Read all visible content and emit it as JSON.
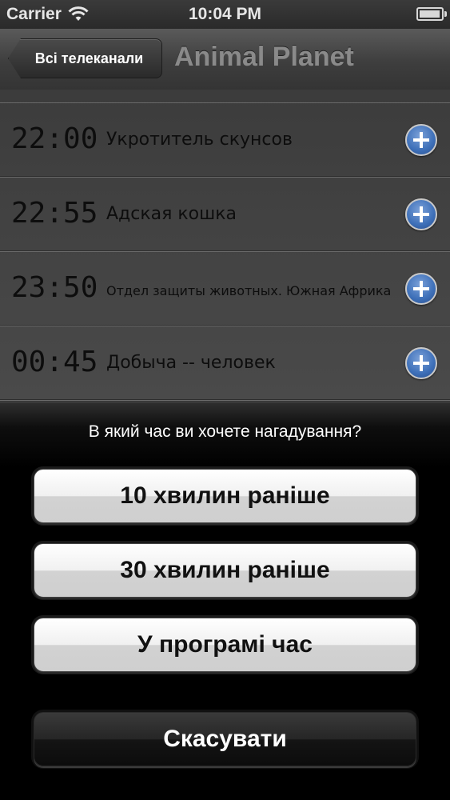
{
  "status_bar": {
    "carrier": "Carrier",
    "time": "10:04 PM",
    "battery_level": 0.95
  },
  "nav": {
    "back_label": "Всі телеканали",
    "title": "Animal Planet"
  },
  "programs": [
    {
      "time": "22:00",
      "title": "Укротитель скунсов"
    },
    {
      "time": "22:55",
      "title": "Адская кошка"
    },
    {
      "time": "23:50",
      "title": "Отдел защиты животных. Южная Африка"
    },
    {
      "time": "00:45",
      "title": "Добыча -- человек"
    }
  ],
  "action_sheet": {
    "prompt": "В який час ви хочете нагадування?",
    "options": [
      "10 хвилин раніше",
      "30 хвилин раніше",
      "У програмі час"
    ],
    "cancel": "Скасувати"
  }
}
